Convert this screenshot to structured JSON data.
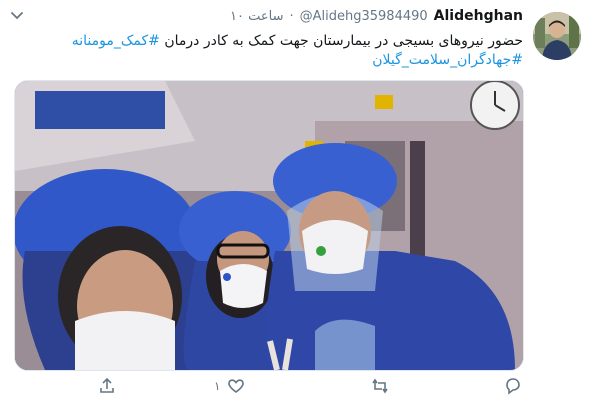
{
  "tweet": {
    "display_name": "Alidehghan",
    "handle": "@Alidehg35984490",
    "separator": "·",
    "time": "۱۰ ساعت",
    "text_main": "حضور نیروهای بسیجی در بیمارستان جهت کمک به کادر درمان",
    "hashtag_1": "#کمک_مومنانه",
    "hashtag_2": "#جهادگران_سلامت_گیلان"
  },
  "actions": {
    "reply_icon": "reply-icon",
    "retweet_icon": "retweet-icon",
    "like_icon": "heart-icon",
    "like_count": "۱",
    "share_icon": "share-icon"
  },
  "icons": {
    "more": "chevron-down-icon"
  },
  "colors": {
    "link": "#1b95e0",
    "muted": "#657786",
    "text": "#14171a"
  }
}
